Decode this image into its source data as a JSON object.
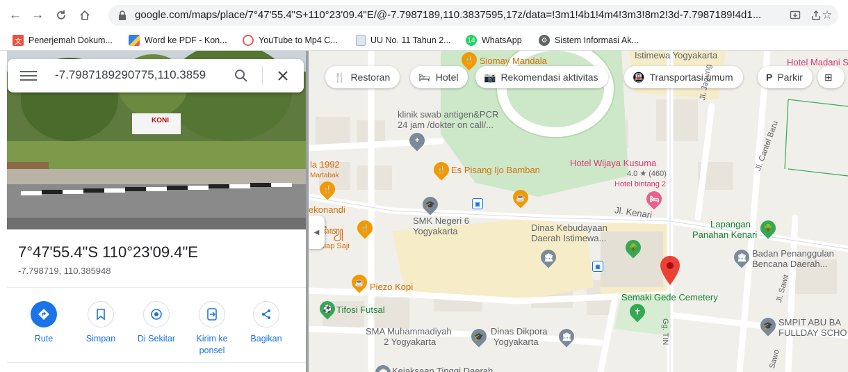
{
  "browser": {
    "url": "google.com/maps/place/7°47'55.4\"S+110°23'09.4\"E/@-7.7987189,110.3837595,17z/data=!3m1!4b1!4m4!3m3!8m2!3d-7.7987189!4d1...",
    "bookmarks": [
      {
        "label": "Penerjemah Dokum...",
        "icon": "translate-doc-icon",
        "color": "#e8523f"
      },
      {
        "label": "Word ke PDF - Kon...",
        "icon": "ilovepdf-icon",
        "color": "#2f80ed"
      },
      {
        "label": "YouTube to Mp4 C...",
        "icon": "converter-icon",
        "color": "#f25a5a"
      },
      {
        "label": "UU No. 11 Tahun 2...",
        "icon": "document-icon",
        "color": "#9fb6cd"
      },
      {
        "label": "WhatsApp",
        "icon": "whatsapp-icon",
        "color": "#25d366"
      },
      {
        "label": "Sistem Informasi Ak...",
        "icon": "globe-icon",
        "color": "#5f6368"
      }
    ]
  },
  "search": {
    "value": "-7.7987189290775,110.3859"
  },
  "place": {
    "title": "7°47'55.4\"S 110°23'09.4\"E",
    "coords": "-7.798719, 110.385948",
    "photo_sign": "KONI"
  },
  "actions": [
    {
      "label": "Rute",
      "icon": "directions-icon"
    },
    {
      "label": "Simpan",
      "icon": "bookmark-icon"
    },
    {
      "label": "Di Sekitar",
      "icon": "nearby-icon"
    },
    {
      "label": "Kirim ke ponsel",
      "icon": "send-to-phone-icon"
    },
    {
      "label": "Bagikan",
      "icon": "share-icon"
    }
  ],
  "chips": [
    {
      "label": "Restoran",
      "icon": "restaurant-icon"
    },
    {
      "label": "Hotel",
      "icon": "hotel-icon"
    },
    {
      "label": "Rekomendasi aktivitas",
      "icon": "camera-icon"
    },
    {
      "label": "Transportasi umum",
      "icon": "transit-icon"
    },
    {
      "label": "Parkir",
      "icon": "parking-icon"
    }
  ],
  "map_labels": {
    "siomay": "Siomay Mandala",
    "istimewa": "Istimewa Yogyakarta",
    "hotel_madani": "Hotel Madani S",
    "klinik": "klinik swab antigen&PCR",
    "klinik2": "24 jam /dokter on call/...",
    "jagung": "Jl. Jagung",
    "cantel": "Jl. Cantel Baru",
    "la1992": "la 1992",
    "martabak": "Martabak",
    "es_pisang": "Es Pisang Ijo Bamban",
    "hotel_wijaya": "Hotel Wijaya Kusuma",
    "hotel_rating": "4.0 ★ (460)",
    "hotel_star": "Hotel bintang 2",
    "kenari": "Jl. Kenari",
    "ekonandi": "ekonandi",
    "javanese": "ꦲꦢꦶꦠꦾ",
    "siap_saji": "an Siap Saji",
    "smk": "SMK Negeri 6",
    "smk2": "Yogyakarta",
    "dinas_keb": "Dinas Kebudayaan",
    "dinas_keb2": "Daerah Istimewa...",
    "lapangan": "Lapangan",
    "lapangan2": "Panahan Kenari",
    "badan": "Badan Penanggulan",
    "badan2": "Bencana Daerah...",
    "piezo": "Piezo Kopi",
    "tifosi": "Tifosi Futsal",
    "semaki": "Semaki Gede Cemetery",
    "sawit": "Jl. Sawit",
    "sma": "SMA Muhammadiyah",
    "sma2": "2 Yogyakarta",
    "dinas_dik": "Dinas Dikpora",
    "dinas_dik2": "Yogyakarta",
    "smpit": "SMPIT ABU BA",
    "smpit2": "FULLDAY SCHO",
    "kejaksaan": "Kejaksaan Tinggi Daerah",
    "gg_tin": "Gg. TIN",
    "sawo": "Sawo"
  },
  "colors": {
    "accent": "#1a73e8",
    "pin_red": "#ea4335",
    "park_green": "#c8e6c9"
  }
}
